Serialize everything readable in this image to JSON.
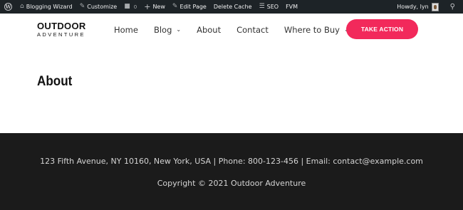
{
  "admin_bar": {
    "wp_logo": "W",
    "site_name": "Blogging Wizard",
    "customize": "Customize",
    "comments_count": "0",
    "new": "New",
    "edit_page": "Edit Page",
    "delete_cache": "Delete Cache",
    "seo": "SEO",
    "fvm": "FVM",
    "howdy": "Howdy, lyn"
  },
  "header": {
    "logo_top": "OUTDOOR",
    "logo_bottom": "ADVENTURE",
    "nav": {
      "home": "Home",
      "blog": "Blog",
      "about": "About",
      "contact": "Contact",
      "where_to_buy": "Where to Buy"
    },
    "cta": "TAKE ACTION"
  },
  "main": {
    "title": "About"
  },
  "footer": {
    "contact_line": "123 Fifth Avenue, NY 10160, New York, USA | Phone: 800-123-456 | Email: contact@example.com",
    "copyright": "Copyright © 2021 Outdoor Adventure"
  },
  "colors": {
    "admin_bar_bg": "#1d2327",
    "accent": "#f2295b",
    "footer_bg": "#1b1b1b"
  },
  "icons": [
    "wordpress-icon",
    "home-icon",
    "brush-icon",
    "comment-icon",
    "plus-icon",
    "pencil-icon",
    "seo-icon",
    "avatar",
    "search-icon",
    "chevron-down-icon"
  ]
}
